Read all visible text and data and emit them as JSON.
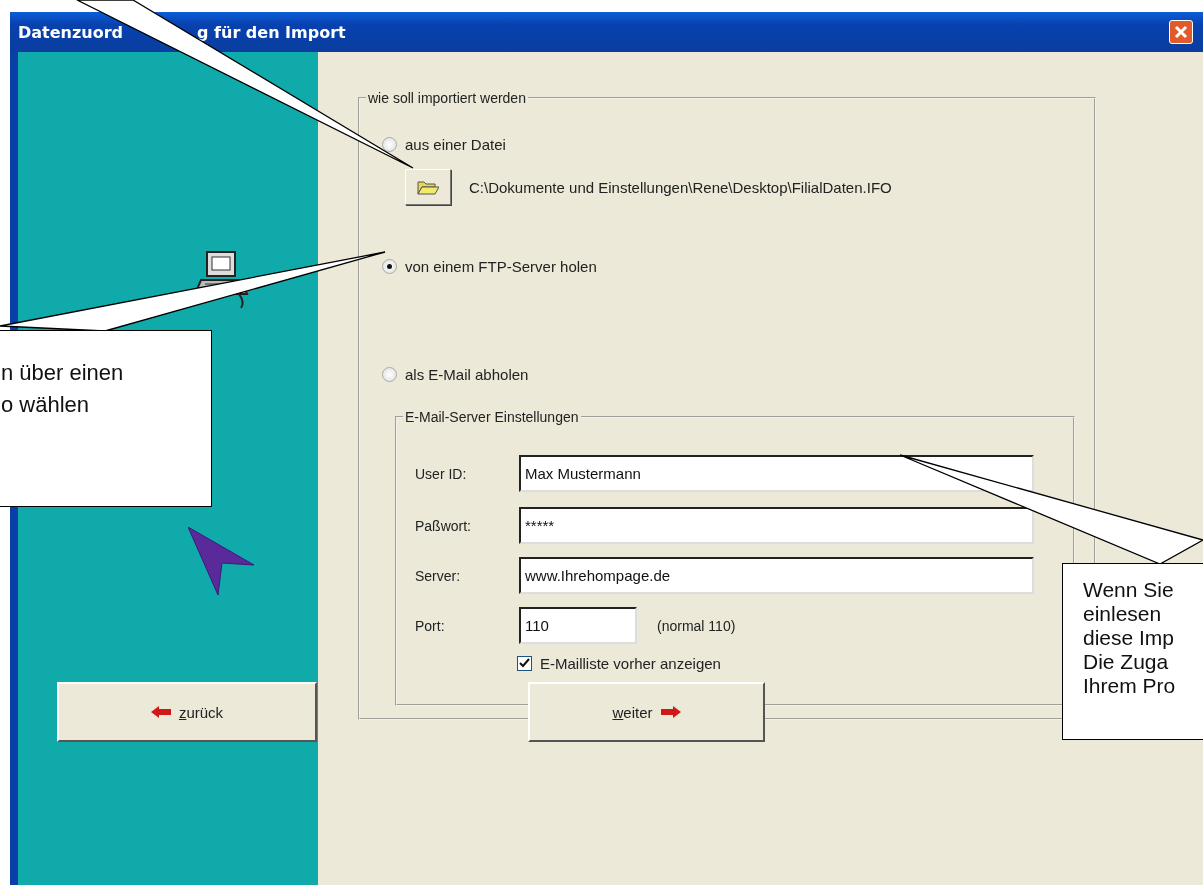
{
  "window": {
    "title_parts": [
      "Datenzuord",
      "g für den Import"
    ]
  },
  "import_group": {
    "legend": "wie soll importiert werden",
    "options": [
      {
        "label": "aus einer Datei",
        "selected": false
      },
      {
        "label": "von einem FTP-Server holen",
        "selected": true
      },
      {
        "label": "als E-Mail abholen",
        "selected": false
      }
    ],
    "file_path": "C:\\Dokumente und Einstellungen\\Rene\\Desktop\\FilialDaten.IFO"
  },
  "mail_group": {
    "legend": "E-Mail-Server Einstellungen",
    "fields": [
      {
        "label": "User ID:",
        "value": "Max Mustermann"
      },
      {
        "label": "Paßwort:",
        "value": "*****"
      },
      {
        "label": "Server:",
        "value": "www.Ihrehompage.de"
      },
      {
        "label": "Port:",
        "value": "110",
        "hint": "(normal 110)"
      }
    ],
    "show_list": {
      "label": "E-Mailliste vorher anzeigen",
      "checked": true
    }
  },
  "buttons": {
    "back": "zurück",
    "next": "weiter"
  },
  "callouts": [
    {
      "text": "n über einen\no wählen"
    },
    {
      "text": "Wenn Sie\neinlesen\ndiese Imp\nDie Zuga\nIhrem Pro"
    }
  ]
}
